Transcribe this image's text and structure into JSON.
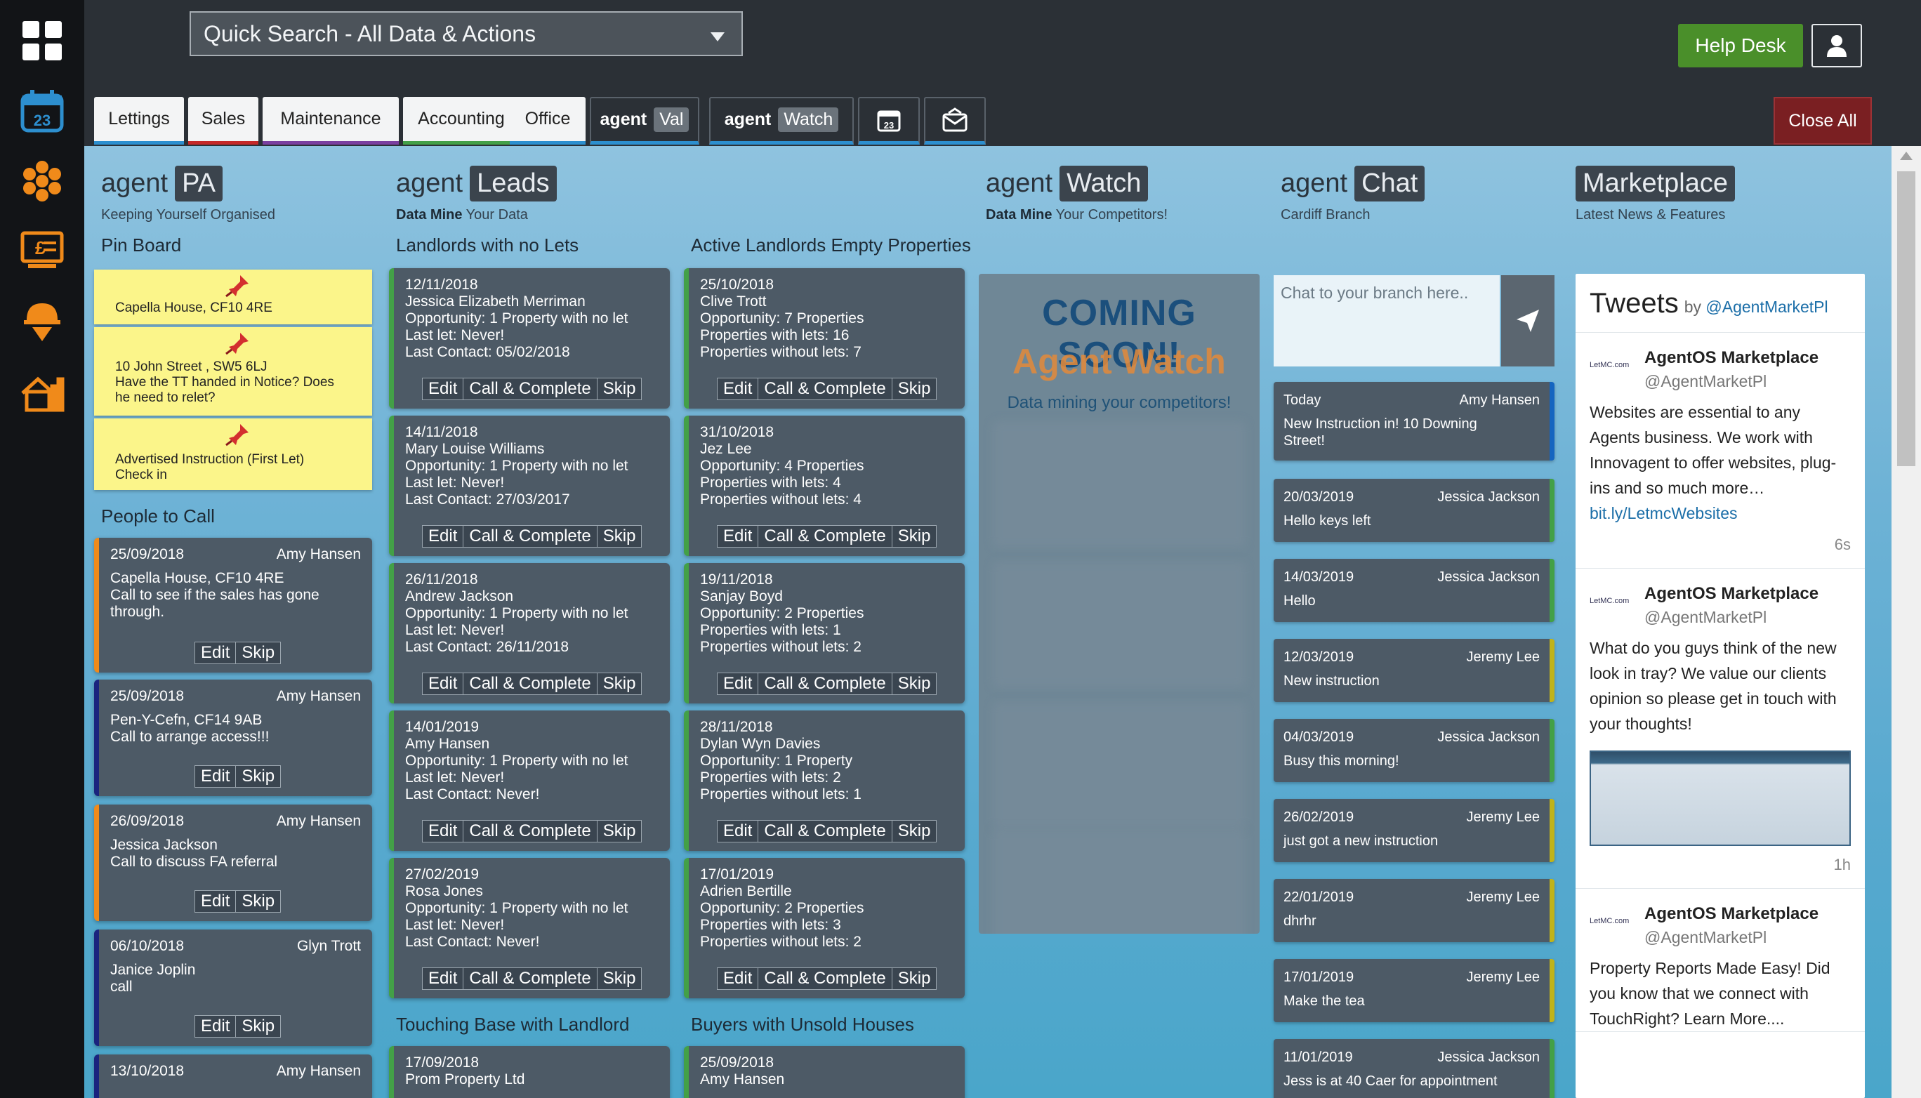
{
  "search": {
    "placeholder": "Quick Search - All Data & Actions"
  },
  "header": {
    "helpdesk": "Help Desk",
    "help_tab": "help",
    "close_all": "Close All"
  },
  "tabs": [
    {
      "label": "Lettings",
      "color": "#2d8fcf"
    },
    {
      "label": "Sales",
      "color": "#c62828"
    },
    {
      "label": "Maintenance",
      "color": "#7b3fa0"
    },
    {
      "label": "Accounting",
      "color": "#43a047"
    },
    {
      "label": "Office",
      "color": "#2d8fcf"
    },
    {
      "brand": "agent",
      "pill": "Val"
    },
    {
      "brand": "agent",
      "pill": "Watch"
    }
  ],
  "rail": {
    "calendar_day": "23"
  },
  "modules": {
    "pa": {
      "brand": "agent",
      "name": "PA",
      "sub": "Keeping Yourself Organised"
    },
    "leads": {
      "brand": "agent",
      "name": "Leads",
      "sub_bold": "Data Mine",
      "sub": " Your Data"
    },
    "watch": {
      "brand": "agent",
      "name": "Watch",
      "sub_bold": "Data Mine",
      "sub": " Your Competitors!"
    },
    "chat": {
      "brand": "agent",
      "name": "Chat",
      "sub": "Cardiff Branch"
    },
    "market": {
      "name": "Marketplace",
      "sub": "Latest News & Features"
    }
  },
  "sections": {
    "pinboard": "Pin Board",
    "people": "People to Call",
    "no_lets": "Landlords with no Lets",
    "empty": "Active Landlords Empty Properties",
    "touching": "Touching Base with Landlord",
    "buyers": "Buyers with Unsold Houses"
  },
  "pins": [
    {
      "l1": "Capella House, CF10 4RE"
    },
    {
      "l1": "10 John Street , SW5 6LJ",
      "l2": "Have the TT handed in Notice? Does",
      "l3": "he need to relet?"
    },
    {
      "l1": "Advertised Instruction (First Let)",
      "l2": "Check in"
    }
  ],
  "people": [
    {
      "date": "25/09/2018",
      "who": "Amy Hansen",
      "l1": "Capella House, CF10 4RE",
      "l2": "Call to see if the sales has gone",
      "l3": "through.",
      "color": "#f08a1a"
    },
    {
      "date": "25/09/2018",
      "who": "Amy Hansen",
      "l1": "Pen-Y-Cefn, CF14 9AB",
      "l2": "Call to arrange access!!!",
      "color": "#1a237e"
    },
    {
      "date": "26/09/2018",
      "who": "Amy Hansen",
      "l1": "Jessica Jackson",
      "l2": "Call to discuss FA referral",
      "color": "#f08a1a"
    },
    {
      "date": "06/10/2018",
      "who": "Glyn Trott",
      "l1": "Janice Joplin",
      "l2": "call",
      "color": "#1a237e"
    },
    {
      "date": "13/10/2018",
      "who": "Amy Hansen",
      "color": "#1a237e"
    }
  ],
  "buttons": {
    "edit": "Edit",
    "call": "Call & Complete",
    "skip": "Skip"
  },
  "no_lets": [
    {
      "date": "12/11/2018",
      "name": "Jessica Elizabeth Merriman",
      "opp": "Opportunity: 1 Property with no let",
      "last": "Last let: Never!",
      "contact": "Last Contact: 05/02/2018"
    },
    {
      "date": "14/11/2018",
      "name": "Mary Louise Williams",
      "opp": "Opportunity: 1 Property with no let",
      "last": "Last let: Never!",
      "contact": "Last Contact: 27/03/2017"
    },
    {
      "date": "26/11/2018",
      "name": "Andrew Jackson",
      "opp": "Opportunity: 1 Property with no let",
      "last": "Last let: Never!",
      "contact": "Last Contact: 26/11/2018"
    },
    {
      "date": "14/01/2019",
      "name": "Amy Hansen",
      "opp": "Opportunity: 1 Property with no let",
      "last": "Last let: Never!",
      "contact": "Last Contact: Never!"
    },
    {
      "date": "27/02/2019",
      "name": "Rosa Jones",
      "opp": "Opportunity: 1 Property with no let",
      "last": "Last let: Never!",
      "contact": "Last Contact: Never!"
    }
  ],
  "empty": [
    {
      "date": "25/10/2018",
      "name": "Clive Trott",
      "opp": "Opportunity: 7 Properties",
      "with": "Properties with lets: 16",
      "without": "Properties without lets: 7"
    },
    {
      "date": "31/10/2018",
      "name": "Jez Lee",
      "opp": "Opportunity: 4 Properties",
      "with": "Properties with lets: 4",
      "without": "Properties without lets: 4"
    },
    {
      "date": "19/11/2018",
      "name": "Sanjay Boyd",
      "opp": "Opportunity: 2 Properties",
      "with": "Properties with lets: 1",
      "without": "Properties without lets: 2"
    },
    {
      "date": "28/11/2018",
      "name": "Dylan Wyn Davies",
      "opp": "Opportunity: 1 Property",
      "with": "Properties with lets: 2",
      "without": "Properties without lets: 1"
    },
    {
      "date": "17/01/2019",
      "name": "Adrien Bertille",
      "opp": "Opportunity: 2 Properties",
      "with": "Properties with lets: 3",
      "without": "Properties without lets: 2"
    }
  ],
  "touching": [
    {
      "date": "17/09/2018",
      "name": "Prom Property Ltd"
    }
  ],
  "buyers": [
    {
      "date": "25/09/2018",
      "name": "Amy Hansen"
    }
  ],
  "watch": {
    "soon": "COMING SOON!",
    "aw": "Agent Watch",
    "dm": "Data mining your competitors!"
  },
  "chat": {
    "placeholder": "Chat to your branch here..",
    "messages": [
      {
        "date": "Today",
        "who": "Amy Hansen",
        "text": "New Instruction in! 10 Downing",
        "text2": "Street!",
        "color": "#1565c0"
      },
      {
        "date": "20/03/2019",
        "who": "Jessica Jackson",
        "text": "Hello keys left",
        "color": "#43a047"
      },
      {
        "date": "14/03/2019",
        "who": "Jessica Jackson",
        "text": "Hello",
        "color": "#43a047"
      },
      {
        "date": "12/03/2019",
        "who": "Jeremy Lee",
        "text": "New instruction",
        "color": "#c0b31a"
      },
      {
        "date": "04/03/2019",
        "who": "Jessica Jackson",
        "text": "Busy this morning!",
        "color": "#43a047"
      },
      {
        "date": "26/02/2019",
        "who": "Jeremy Lee",
        "text": "just got a new instruction",
        "color": "#c0b31a"
      },
      {
        "date": "22/01/2019",
        "who": "Jeremy Lee",
        "text": "dhrhr",
        "color": "#c0b31a"
      },
      {
        "date": "17/01/2019",
        "who": "Jeremy Lee",
        "text": "Make the tea",
        "color": "#c0b31a"
      },
      {
        "date": "11/01/2019",
        "who": "Jessica Jackson",
        "text": "Jess is at 40 Caer for appointment",
        "color": "#43a047"
      }
    ]
  },
  "tweets": {
    "title": "Tweets",
    "by": "by",
    "handle_link": "@AgentMarketPl",
    "items": [
      {
        "logo": "LetMC.com",
        "name": "AgentOS Marketplace",
        "handle": "@AgentMarketPl",
        "text": "Websites are essential to any Agents business. We work with Innovagent to offer websites, plug-ins and so much more…",
        "link": "bit.ly/LetmcWebsites",
        "age": "6s"
      },
      {
        "logo": "LetMC.com",
        "name": "AgentOS Marketplace",
        "handle": "@AgentMarketPl",
        "text": "What do you guys think of the new look in tray? We value our clients opinion so please get in touch with your thoughts!",
        "age": "1h"
      },
      {
        "logo": "LetMC.com",
        "name": "AgentOS Marketplace",
        "handle": "@AgentMarketPl",
        "text": "Property Reports Made Easy! Did you know that we connect with TouchRight?  Learn More...."
      }
    ]
  }
}
